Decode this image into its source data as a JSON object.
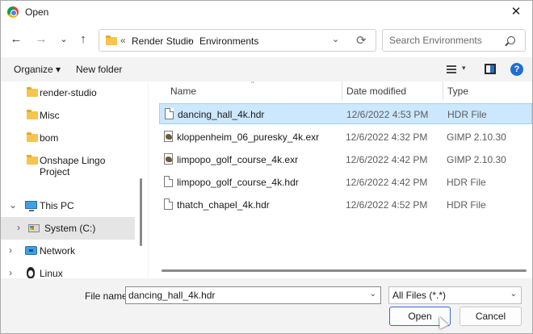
{
  "window": {
    "title": "Open",
    "close_glyph": "✕"
  },
  "nav": {
    "back_glyph": "←",
    "forward_glyph": "→",
    "recent_glyph": "⌄",
    "up_glyph": "↑",
    "address": {
      "overflow_glyph": "«",
      "segments": [
        "Render Studio",
        "Environments"
      ],
      "separator": "›",
      "dropdown_glyph": "⌄",
      "refresh_glyph": "⟳"
    },
    "search": {
      "placeholder": "Search Environments"
    }
  },
  "toolbar": {
    "organize_label": "Organize ▾",
    "new_folder_label": "New folder",
    "view_dd_glyph": "▾",
    "help_glyph": "?"
  },
  "sidebar": {
    "items": [
      {
        "label": "render-studio",
        "icon": "folder-icon"
      },
      {
        "label": "Misc",
        "icon": "folder-icon"
      },
      {
        "label": "bom",
        "icon": "folder-icon"
      },
      {
        "label": "Onshape Lingo Project",
        "icon": "folder-icon"
      },
      {
        "label": "This PC",
        "icon": "pc-icon",
        "expander": "⌄"
      },
      {
        "label": "System (C:)",
        "icon": "drive-icon",
        "expander": "›",
        "selected": true
      },
      {
        "label": "Network",
        "icon": "network-icon",
        "expander": "›"
      },
      {
        "label": "Linux",
        "icon": "linux-icon",
        "expander": "›"
      }
    ]
  },
  "columns": {
    "name": "Name",
    "date": "Date modified",
    "type": "Type",
    "sort_glyph": "^"
  },
  "files": [
    {
      "name": "dancing_hall_4k.hdr",
      "date": "12/6/2022 4:53 PM",
      "type": "HDR File",
      "icon": "document-icon",
      "selected": true
    },
    {
      "name": "kloppenheim_06_puresky_4k.exr",
      "date": "12/6/2022 4:32 PM",
      "type": "GIMP 2.10.30",
      "icon": "gimp-file-icon"
    },
    {
      "name": "limpopo_golf_course_4k.exr",
      "date": "12/6/2022 4:42 PM",
      "type": "GIMP 2.10.30",
      "icon": "gimp-file-icon"
    },
    {
      "name": "limpopo_golf_course_4k.hdr",
      "date": "12/6/2022 4:42 PM",
      "type": "HDR File",
      "icon": "document-icon"
    },
    {
      "name": "thatch_chapel_4k.hdr",
      "date": "12/6/2022 4:52 PM",
      "type": "HDR File",
      "icon": "document-icon"
    }
  ],
  "bottom": {
    "file_name_label": "File name:",
    "file_name_value": "dancing_hall_4k.hdr",
    "dropdown_glyph": "⌄",
    "file_type_value": "All Files (*.*)",
    "open_label": "Open",
    "cancel_label": "Cancel"
  },
  "colors": {
    "accent": "#1f6fd1",
    "selection": "#cce8ff",
    "sidebar_selection": "#e5e5e5"
  }
}
